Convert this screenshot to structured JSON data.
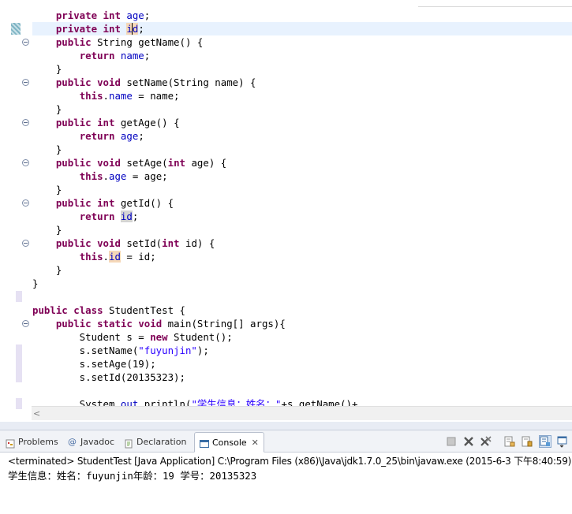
{
  "editor": {
    "lines": [
      {
        "parts": [
          {
            "t": "    "
          },
          {
            "t": "private",
            "c": "kw"
          },
          {
            "t": " "
          },
          {
            "t": "int",
            "c": "kw"
          },
          {
            "t": " "
          },
          {
            "t": "age",
            "c": "fld"
          },
          {
            "t": ";"
          }
        ]
      },
      {
        "parts": [
          {
            "t": "    "
          },
          {
            "t": "private",
            "c": "kw"
          },
          {
            "t": " "
          },
          {
            "t": "int",
            "c": "kw"
          },
          {
            "t": " "
          },
          {
            "t": "id",
            "c": "fld occ-w",
            "caret": 1
          },
          {
            "t": ";"
          }
        ],
        "current": true
      },
      {
        "parts": [
          {
            "t": "    "
          },
          {
            "t": "public",
            "c": "kw"
          },
          {
            "t": " String getName() {"
          }
        ],
        "fold": true
      },
      {
        "parts": [
          {
            "t": "        "
          },
          {
            "t": "return",
            "c": "kw"
          },
          {
            "t": " "
          },
          {
            "t": "name",
            "c": "fld"
          },
          {
            "t": ";"
          }
        ]
      },
      {
        "parts": [
          {
            "t": "    }"
          }
        ]
      },
      {
        "parts": [
          {
            "t": "    "
          },
          {
            "t": "public",
            "c": "kw"
          },
          {
            "t": " "
          },
          {
            "t": "void",
            "c": "kw"
          },
          {
            "t": " setName(String name) {"
          }
        ],
        "fold": true
      },
      {
        "parts": [
          {
            "t": "        "
          },
          {
            "t": "this",
            "c": "kw"
          },
          {
            "t": "."
          },
          {
            "t": "name",
            "c": "fld"
          },
          {
            "t": " = name;"
          }
        ]
      },
      {
        "parts": [
          {
            "t": "    }"
          }
        ]
      },
      {
        "parts": [
          {
            "t": "    "
          },
          {
            "t": "public",
            "c": "kw"
          },
          {
            "t": " "
          },
          {
            "t": "int",
            "c": "kw"
          },
          {
            "t": " getAge() {"
          }
        ],
        "fold": true
      },
      {
        "parts": [
          {
            "t": "        "
          },
          {
            "t": "return",
            "c": "kw"
          },
          {
            "t": " "
          },
          {
            "t": "age",
            "c": "fld"
          },
          {
            "t": ";"
          }
        ]
      },
      {
        "parts": [
          {
            "t": "    }"
          }
        ]
      },
      {
        "parts": [
          {
            "t": "    "
          },
          {
            "t": "public",
            "c": "kw"
          },
          {
            "t": " "
          },
          {
            "t": "void",
            "c": "kw"
          },
          {
            "t": " setAge("
          },
          {
            "t": "int",
            "c": "kw"
          },
          {
            "t": " age) {"
          }
        ],
        "fold": true
      },
      {
        "parts": [
          {
            "t": "        "
          },
          {
            "t": "this",
            "c": "kw"
          },
          {
            "t": "."
          },
          {
            "t": "age",
            "c": "fld"
          },
          {
            "t": " = age;"
          }
        ]
      },
      {
        "parts": [
          {
            "t": "    }"
          }
        ]
      },
      {
        "parts": [
          {
            "t": "    "
          },
          {
            "t": "public",
            "c": "kw"
          },
          {
            "t": " "
          },
          {
            "t": "int",
            "c": "kw"
          },
          {
            "t": " getId() {"
          }
        ],
        "fold": true
      },
      {
        "parts": [
          {
            "t": "        "
          },
          {
            "t": "return",
            "c": "kw"
          },
          {
            "t": " "
          },
          {
            "t": "id",
            "c": "fld occ-r"
          },
          {
            "t": ";"
          }
        ]
      },
      {
        "parts": [
          {
            "t": "    }"
          }
        ]
      },
      {
        "parts": [
          {
            "t": "    "
          },
          {
            "t": "public",
            "c": "kw"
          },
          {
            "t": " "
          },
          {
            "t": "void",
            "c": "kw"
          },
          {
            "t": " setId("
          },
          {
            "t": "int",
            "c": "kw"
          },
          {
            "t": " id) {"
          }
        ],
        "fold": true
      },
      {
        "parts": [
          {
            "t": "        "
          },
          {
            "t": "this",
            "c": "kw"
          },
          {
            "t": "."
          },
          {
            "t": "id",
            "c": "fld occ-w"
          },
          {
            "t": " = id;"
          }
        ]
      },
      {
        "parts": [
          {
            "t": "    }"
          }
        ]
      },
      {
        "parts": [
          {
            "t": "}"
          }
        ]
      },
      {
        "parts": [
          {
            "t": ""
          }
        ]
      },
      {
        "parts": [
          {
            "t": "public",
            "c": "kw"
          },
          {
            "t": " "
          },
          {
            "t": "class",
            "c": "kw"
          },
          {
            "t": " StudentTest {"
          }
        ]
      },
      {
        "parts": [
          {
            "t": "    "
          },
          {
            "t": "public",
            "c": "kw"
          },
          {
            "t": " "
          },
          {
            "t": "static",
            "c": "kw"
          },
          {
            "t": " "
          },
          {
            "t": "void",
            "c": "kw"
          },
          {
            "t": " main(String[] args){"
          }
        ],
        "fold": true
      },
      {
        "parts": [
          {
            "t": "        Student s = "
          },
          {
            "t": "new",
            "c": "kw"
          },
          {
            "t": " Student();"
          }
        ]
      },
      {
        "parts": [
          {
            "t": "        s.setName("
          },
          {
            "t": "\"fuyunjin\"",
            "c": "str"
          },
          {
            "t": ");"
          }
        ]
      },
      {
        "parts": [
          {
            "t": "        s.setAge(19);"
          }
        ]
      },
      {
        "parts": [
          {
            "t": "        s.setId(20135323);"
          }
        ]
      },
      {
        "parts": [
          {
            "t": ""
          }
        ]
      },
      {
        "parts": [
          {
            "t": "        System."
          },
          {
            "t": "out",
            "c": "fld"
          },
          {
            "t": ".println("
          },
          {
            "t": "\"学生信息：姓名：\"",
            "c": "str"
          },
          {
            "t": "+s.getName()+"
          }
        ]
      }
    ]
  },
  "console_view": {
    "tabs": [
      {
        "label": "Problems",
        "icon": "problems-icon"
      },
      {
        "label": "Javadoc",
        "icon": "javadoc-icon"
      },
      {
        "label": "Declaration",
        "icon": "declaration-icon"
      },
      {
        "label": "Console",
        "icon": "console-icon",
        "active": true
      }
    ],
    "close_glyph": "✕",
    "toolbar_icons": [
      "terminate-icon",
      "remove-launch-icon",
      "remove-all-terminated-icon",
      "clear-console-icon",
      "scroll-lock-icon",
      "pin-console-icon",
      "display-selected-console-icon",
      "open-console-icon"
    ],
    "status": "<terminated> StudentTest [Java Application] C:\\Program Files (x86)\\Java\\jdk1.7.0_25\\bin\\javaw.exe (2015-6-3 下午8:40:59)",
    "output": "学生信息：姓名：fuyunjin年龄：19 学号：20135323"
  },
  "colors": {
    "keyword": "#7f0055",
    "field": "#0000c0",
    "string": "#2a00ff",
    "current_line": "#e8f2fe"
  }
}
